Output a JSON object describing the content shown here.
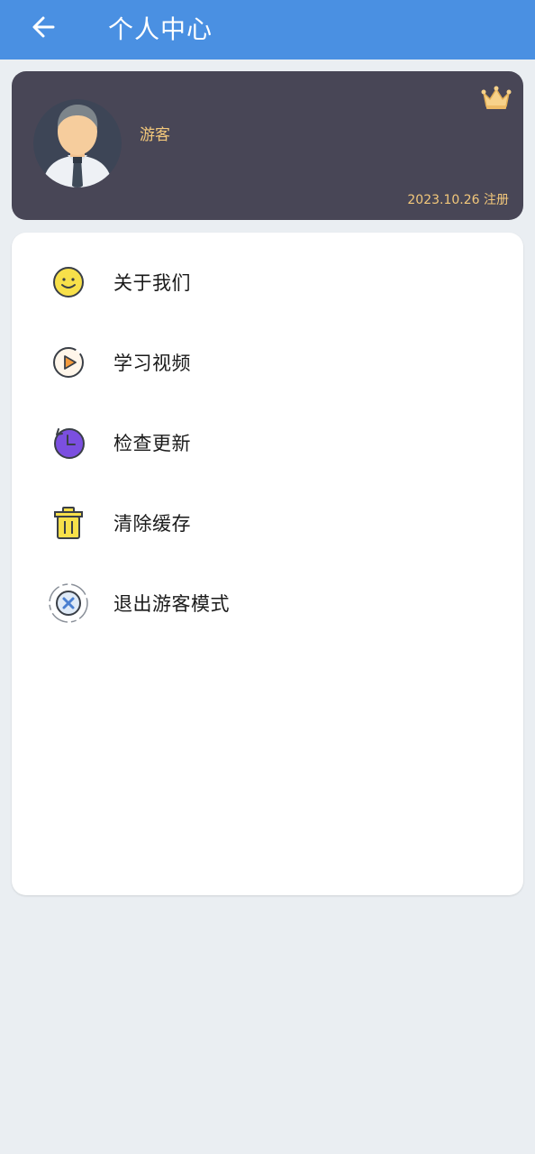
{
  "header": {
    "title": "个人中心",
    "back_icon": "back-arrow-icon",
    "background_color": "#4a90e2"
  },
  "profile": {
    "username": "游客",
    "registration": "2023.10.26 注册",
    "avatar_icon": "user-avatar-icon",
    "badge_icon": "crown-icon",
    "card_color": "#484656",
    "accent_color": "#f3c87b"
  },
  "menu": {
    "items": [
      {
        "label": "关于我们",
        "icon": "smiley-icon"
      },
      {
        "label": "学习视频",
        "icon": "play-video-icon"
      },
      {
        "label": "检查更新",
        "icon": "update-clock-icon"
      },
      {
        "label": "清除缓存",
        "icon": "trash-icon"
      },
      {
        "label": "退出游客模式",
        "icon": "exit-x-icon"
      }
    ]
  }
}
